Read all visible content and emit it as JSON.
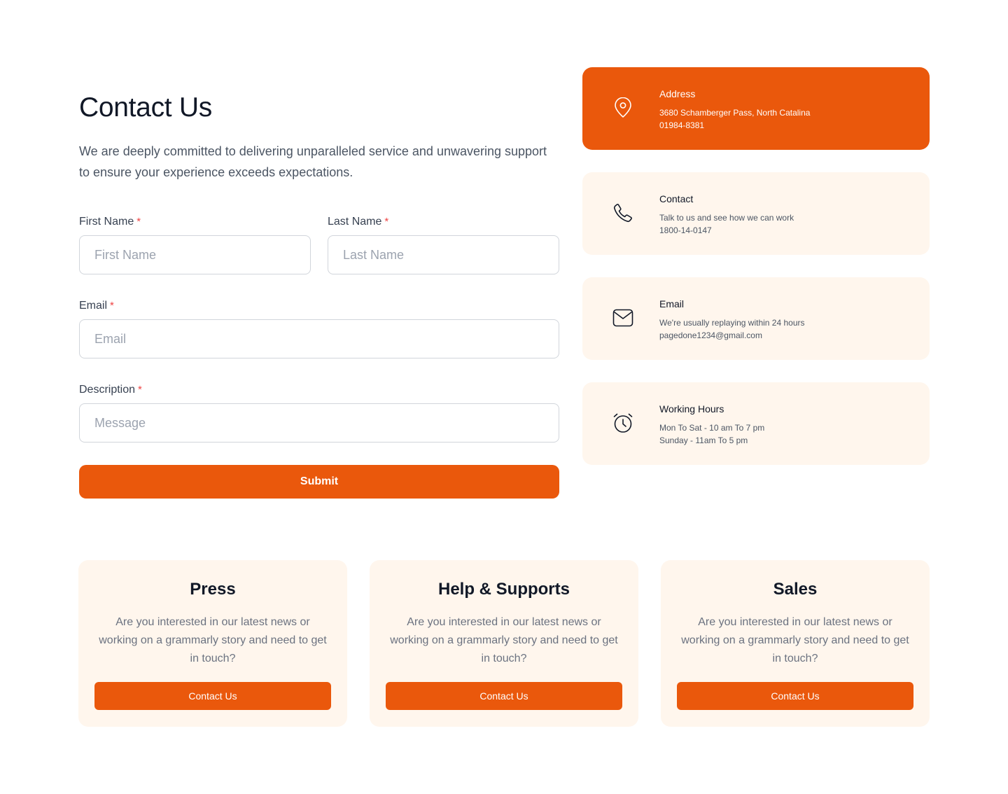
{
  "header": {
    "title": "Contact Us",
    "subtitle": "We are deeply committed to delivering unparalleled service and unwavering support to ensure your experience exceeds expectations."
  },
  "form": {
    "first_name": {
      "label": "First Name",
      "placeholder": "First Name",
      "value": ""
    },
    "last_name": {
      "label": "Last Name",
      "placeholder": "Last Name",
      "value": ""
    },
    "email": {
      "label": "Email",
      "placeholder": "Email",
      "value": ""
    },
    "description": {
      "label": "Description",
      "placeholder": "Message",
      "value": ""
    },
    "required_marker": "*",
    "submit_label": "Submit"
  },
  "info_cards": [
    {
      "title": "Address",
      "line1": "3680 Schamberger Pass, North Catalina",
      "line2": "01984-8381",
      "icon": "map-pin-icon",
      "active": true
    },
    {
      "title": "Contact",
      "line1": "Talk to us and see how we can work",
      "line2": "1800-14-0147",
      "icon": "phone-icon",
      "active": false
    },
    {
      "title": "Email",
      "line1": "We're usually replaying within 24 hours",
      "line2": "pagedone1234@gmail.com",
      "icon": "mail-icon",
      "active": false
    },
    {
      "title": "Working Hours",
      "line1": "Mon To Sat - 10 am To 7 pm",
      "line2": "Sunday - 11am To 5 pm",
      "icon": "alarm-clock-icon",
      "active": false
    }
  ],
  "bottom_cards": [
    {
      "title": "Press",
      "text": "Are you interested in our latest news or working on a grammarly story and need to get in touch?",
      "button": "Contact Us"
    },
    {
      "title": "Help & Supports",
      "text": "Are you interested in our latest news or working on a grammarly story and need to get in touch?",
      "button": "Contact Us"
    },
    {
      "title": "Sales",
      "text": "Are you interested in our latest news or working on a grammarly story and need to get in touch?",
      "button": "Contact Us"
    }
  ],
  "colors": {
    "accent": "#ea580c",
    "card_bg": "#fff6ed",
    "required": "#ef4444"
  }
}
